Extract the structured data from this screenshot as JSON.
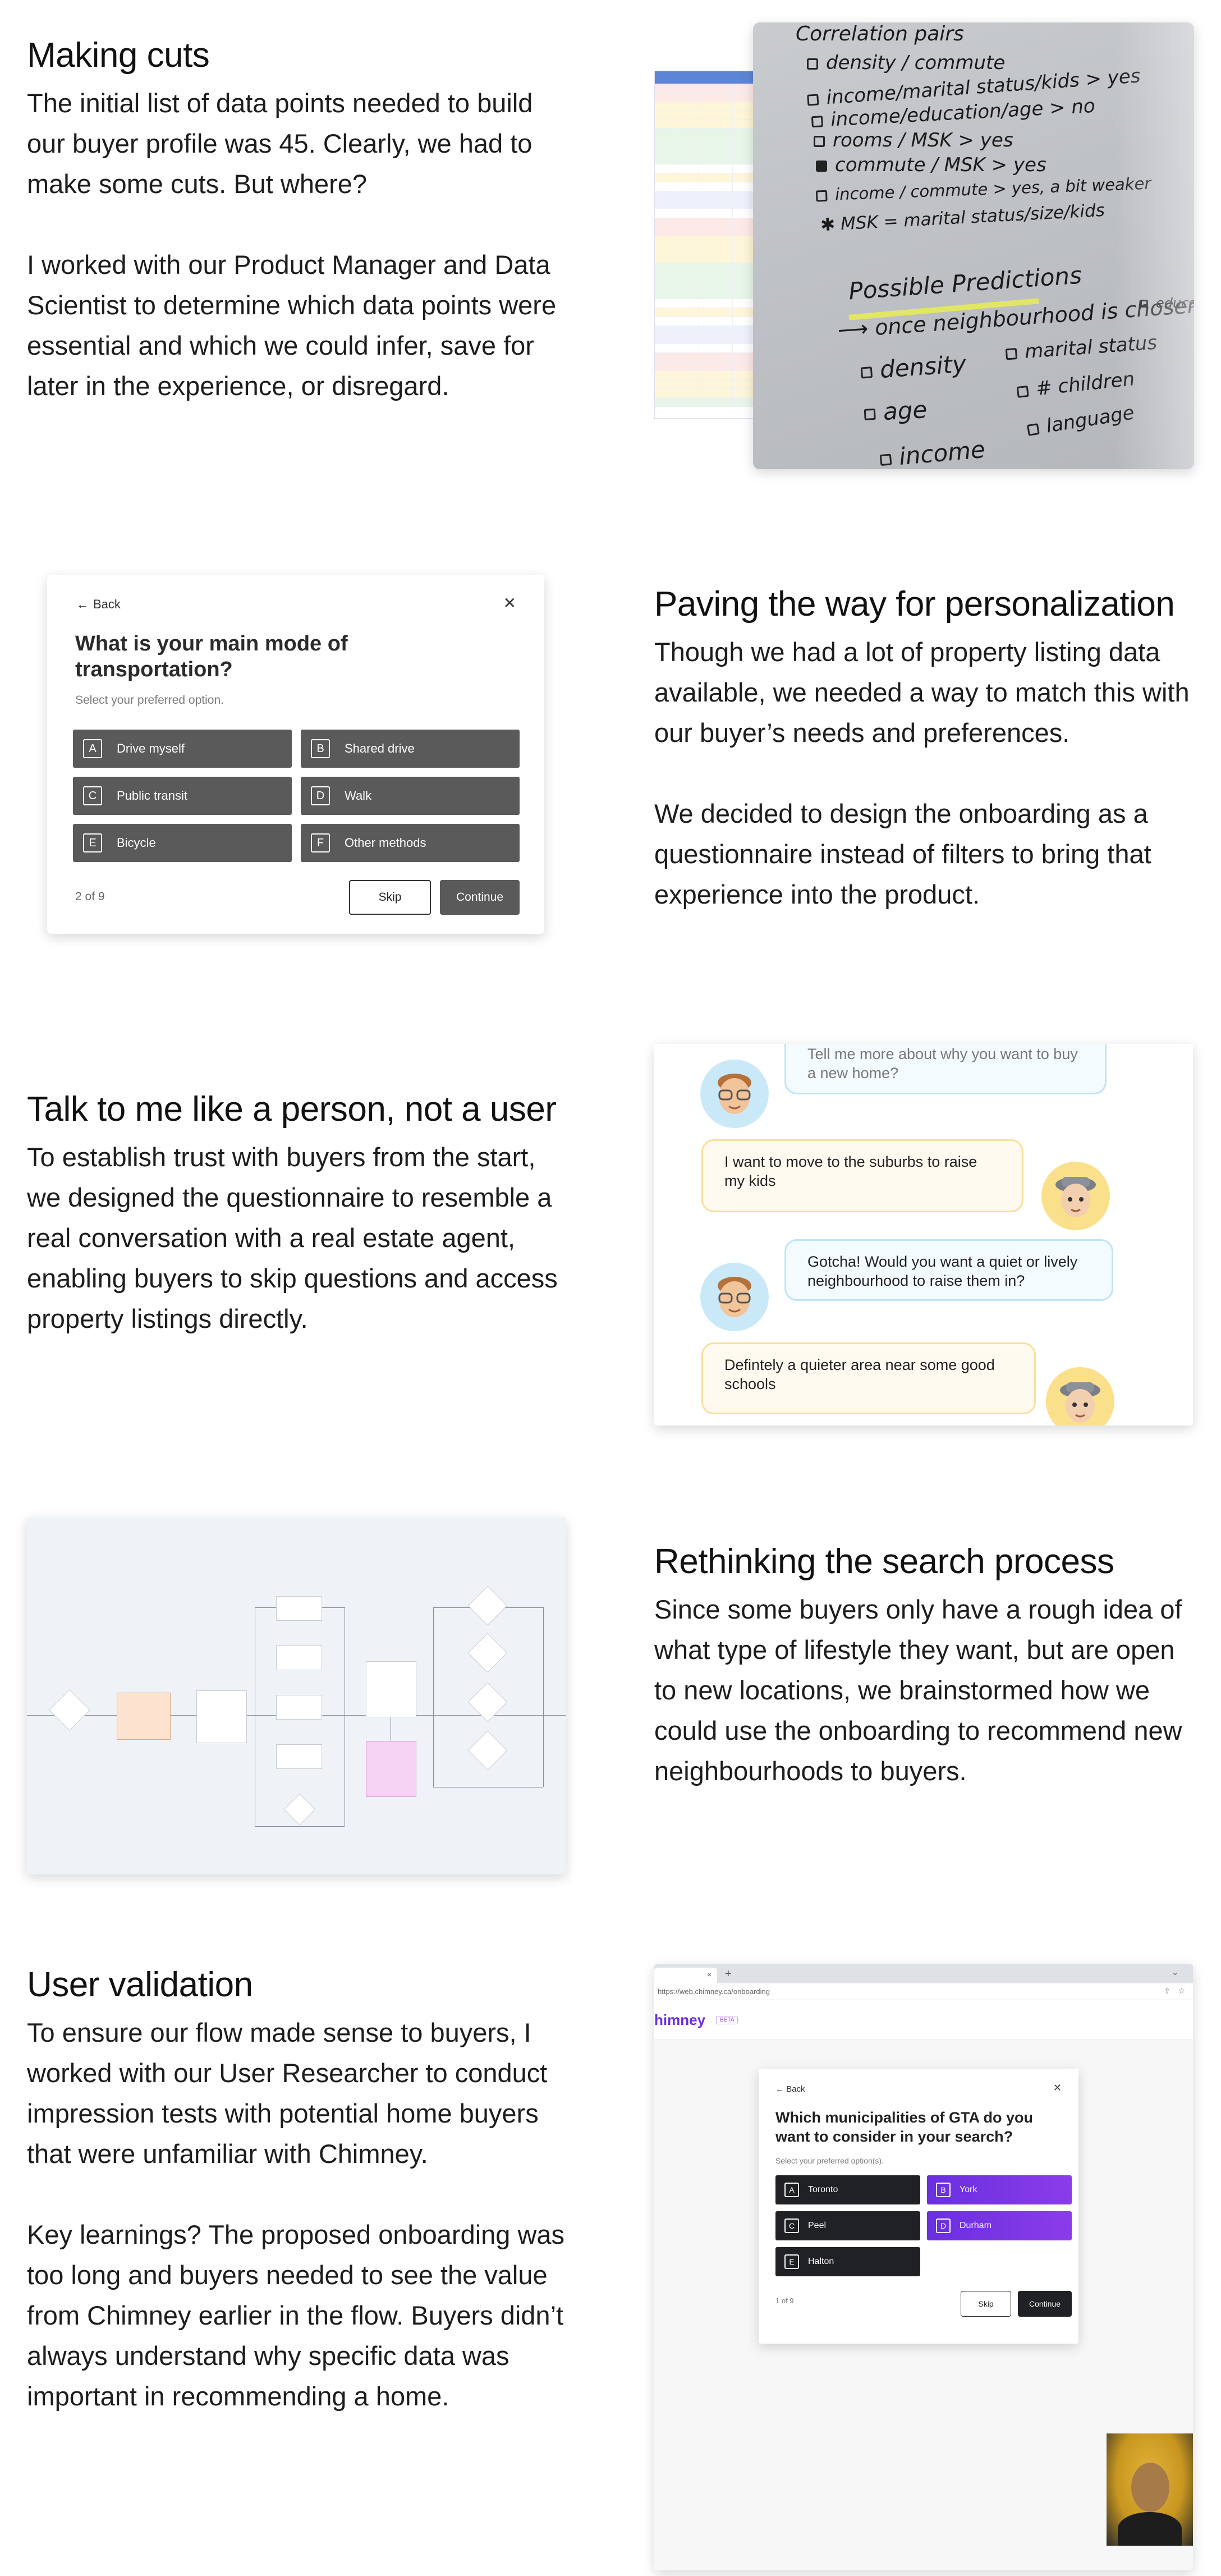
{
  "sections": {
    "making_cuts": {
      "title": "Making cuts",
      "p1": "The initial list of data points needed to build our buyer profile was 45. Clearly, we had to make some cuts. But where?",
      "p2": "I worked with our Product Manager and Data Scientist to determine which data points were essential and which we could infer, save for later in the experience, or disregard."
    },
    "personalization": {
      "title": "Paving the way for personalization",
      "p1": "Though we had a lot of property listing data available, we needed a way to match this with our buyer’s needs and preferences.",
      "p2": "We decided to design the onboarding as a questionnaire instead of filters to bring that experience into the product."
    },
    "talk": {
      "title": "Talk to me like a person, not a user",
      "p1": "To establish trust with buyers from the start, we designed the questionnaire to resemble a real conversation with a real estate agent, enabling buyers to skip questions and access property listings directly."
    },
    "rethinking": {
      "title": "Rethinking the search process",
      "p1": "Since some buyers only have a rough idea of what type of lifestyle they want, but are open to new locations, we brainstormed how we could use the onboarding to recommend new neighbourhoods to buyers."
    },
    "validation": {
      "title": "User validation",
      "p1": "To ensure our flow made sense to buyers, I worked with our User Researcher to conduct impression tests with potential home buyers that were unfamiliar with Chimney.",
      "p2": "Key learnings? The proposed onboarding was too long and buyers needed to see the value from Chimney earlier in the flow. Buyers didn’t always understand why specific data was important in recommending a home."
    }
  },
  "notes": {
    "lines": [
      "Correlation pairs",
      "density / commute",
      "income/marital status/kids > yes",
      "income/education/age > no",
      "rooms / MSK > yes",
      "commute / MSK > yes",
      "income / commute > yes, a bit weaker",
      "MSK = marital status/size/kids"
    ],
    "predictions_title": "Possible Predictions",
    "predictions_sub": "once neighbourhood is chosen",
    "pred_left": [
      "density",
      "age",
      "income"
    ],
    "pred_right": [
      "marital status",
      "# children",
      "language"
    ],
    "side_note": "education"
  },
  "questionnaire": {
    "back": "Back",
    "close": "✕",
    "question": "What is your main mode of transportation?",
    "hint": "Select your preferred option.",
    "options": [
      {
        "key": "A",
        "label": "Drive myself"
      },
      {
        "key": "B",
        "label": "Shared drive"
      },
      {
        "key": "C",
        "label": "Public transit"
      },
      {
        "key": "D",
        "label": "Walk"
      },
      {
        "key": "E",
        "label": "Bicycle"
      },
      {
        "key": "F",
        "label": "Other methods"
      }
    ],
    "progress": "2 of 9",
    "skip": "Skip",
    "continue": "Continue"
  },
  "chat": {
    "messages": [
      "Tell me more about why you want to buy a new home?",
      "I want to move to the suburbs to raise my kids",
      "Gotcha! Would you want a quiet or lively neighbourhood to raise them in?",
      "Defintely a quieter area near some good schools"
    ]
  },
  "browser": {
    "url": "https://web.chimney.ca/onboarding",
    "url_host": "web.chimney.ca",
    "logo": "himney",
    "beta": "BETA",
    "back": "Back",
    "question": "Which municipalities of GTA do you want to consider in your search?",
    "hint": "Select your preferred option(s).",
    "options": [
      {
        "key": "A",
        "label": "Toronto"
      },
      {
        "key": "B",
        "label": "York"
      },
      {
        "key": "C",
        "label": "Peel"
      },
      {
        "key": "D",
        "label": "Durham"
      },
      {
        "key": "E",
        "label": "Halton"
      }
    ],
    "progress": "1 of 9",
    "skip": "Skip",
    "continue": "Continue",
    "colors": {
      "dark": "#202124",
      "purple_from": "#6a2fe0",
      "purple_to": "#8b3ce8"
    }
  }
}
